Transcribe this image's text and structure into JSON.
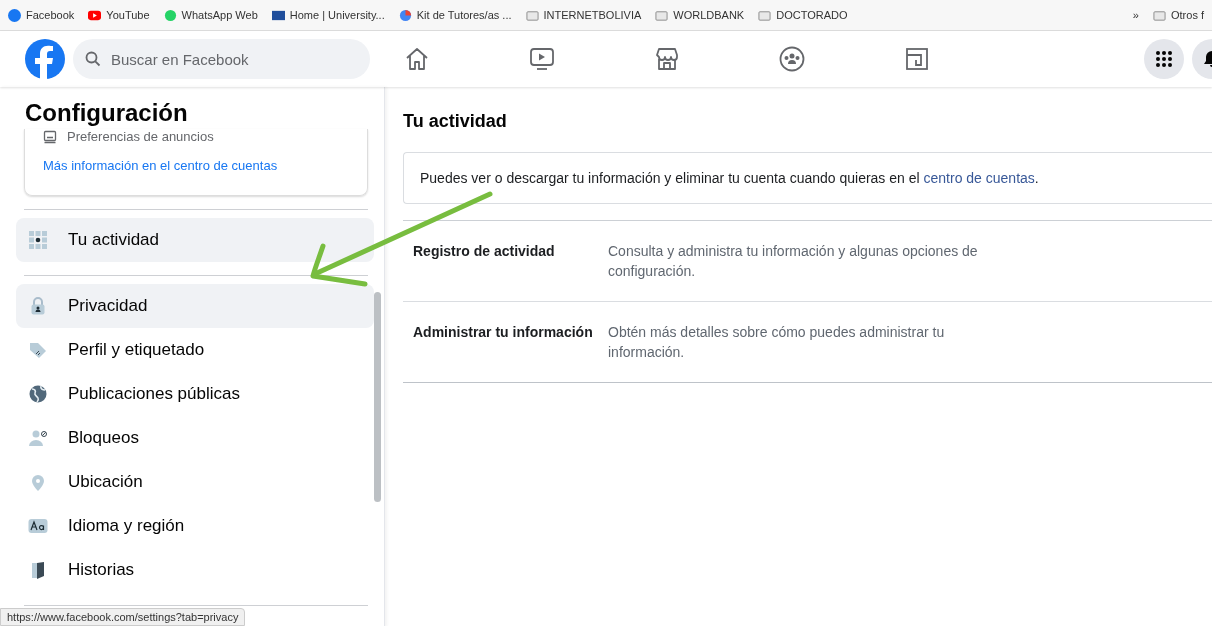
{
  "bookmarks": [
    {
      "label": "Facebook",
      "kind": "fb"
    },
    {
      "label": "YouTube",
      "kind": "yt"
    },
    {
      "label": "WhatsApp Web",
      "kind": "wa"
    },
    {
      "label": "Home | University...",
      "kind": "uni"
    },
    {
      "label": "Kit de Tutores/as ...",
      "kind": "kit"
    },
    {
      "label": "INTERNETBOLIVIA",
      "kind": "folder"
    },
    {
      "label": "WORLDBANK",
      "kind": "folder"
    },
    {
      "label": "DOCTORADO",
      "kind": "folder"
    }
  ],
  "bookmarks_more": "»",
  "bookmarks_other": "Otros f",
  "search": {
    "placeholder": "Buscar en Facebook"
  },
  "nav": [
    {
      "kind": "home"
    },
    {
      "kind": "video"
    },
    {
      "kind": "market"
    },
    {
      "kind": "groups"
    },
    {
      "kind": "gaming"
    }
  ],
  "sidebar": {
    "title": "Configuración",
    "card": {
      "item": "Preferencias de anuncios",
      "link": "Más información en el centro de cuentas"
    },
    "activity": {
      "label": "Tu actividad",
      "selected": true
    },
    "items": [
      {
        "label": "Privacidad",
        "kind": "lock",
        "highlighted": true
      },
      {
        "label": "Perfil y etiquetado",
        "kind": "tag",
        "highlighted": false
      },
      {
        "label": "Publicaciones públicas",
        "kind": "globe",
        "highlighted": false
      },
      {
        "label": "Bloqueos",
        "kind": "block",
        "highlighted": false
      },
      {
        "label": "Ubicación",
        "kind": "pin",
        "highlighted": false
      },
      {
        "label": "Idioma y región",
        "kind": "lang",
        "highlighted": false
      },
      {
        "label": "Historias",
        "kind": "story",
        "highlighted": false
      }
    ]
  },
  "content": {
    "title": "Tu actividad",
    "notice": {
      "text": "Puedes ver o descargar tu información y eliminar tu cuenta cuando quieras en el",
      "link": "centro de cuentas",
      "end": "."
    },
    "rows": [
      {
        "label": "Registro de actividad",
        "description": "Consulta y administra tu información y algunas opciones de configuración."
      },
      {
        "label": "Administrar tu información",
        "description": "Obtén más detalles sobre cómo puedes administrar tu información."
      }
    ]
  },
  "status_url": "https://www.facebook.com/settings?tab=privacy"
}
